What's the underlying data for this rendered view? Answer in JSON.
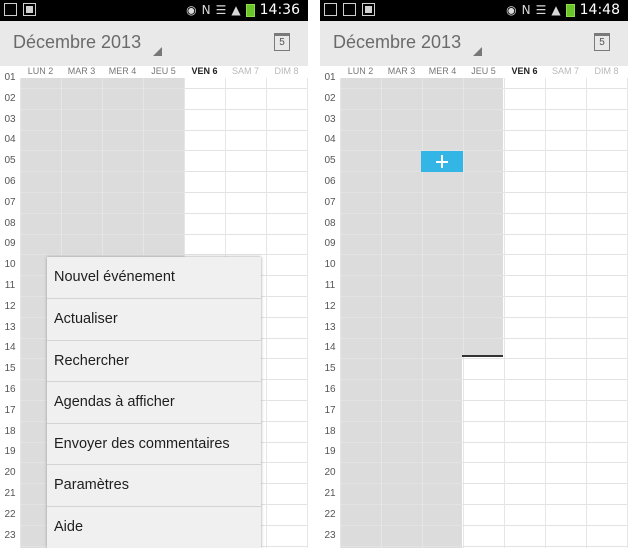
{
  "left": {
    "time": "14:36",
    "month": "Décembre 2013",
    "today_icon": "5",
    "days": [
      {
        "label": "LUN 2"
      },
      {
        "label": "MAR 3"
      },
      {
        "label": "MER 4"
      },
      {
        "label": "JEU 5"
      },
      {
        "label": "VEN 6"
      },
      {
        "label": "SAM 7"
      },
      {
        "label": "DIM 8"
      }
    ],
    "hours": [
      "01",
      "02",
      "03",
      "04",
      "05",
      "06",
      "07",
      "08",
      "09",
      "10",
      "11",
      "12",
      "13",
      "14",
      "15",
      "16",
      "17",
      "18",
      "19",
      "20",
      "21",
      "22",
      "23"
    ],
    "menu": [
      "Nouvel événement",
      "Actualiser",
      "Rechercher",
      "Agendas à afficher",
      "Envoyer des commentaires",
      "Paramètres",
      "Aide"
    ]
  },
  "right": {
    "time": "14:48",
    "month": "Décembre 2013",
    "today_icon": "5",
    "days": [
      {
        "label": "LUN 2"
      },
      {
        "label": "MAR 3"
      },
      {
        "label": "MER 4"
      },
      {
        "label": "JEU 5"
      },
      {
        "label": "VEN 6"
      },
      {
        "label": "SAM 7"
      },
      {
        "label": "DIM 8"
      }
    ],
    "hours": [
      "01",
      "02",
      "03",
      "04",
      "05",
      "06",
      "07",
      "08",
      "09",
      "10",
      "11",
      "12",
      "13",
      "14",
      "15",
      "16",
      "17",
      "18",
      "19",
      "20",
      "21",
      "22",
      "23"
    ]
  },
  "colors": {
    "accent": "#33b5e5",
    "battery": "#6bc42a",
    "shade": "#dcdcdc"
  },
  "icons": [
    "notification-icon",
    "sd-card-icon",
    "eye-icon",
    "nfc-icon",
    "wifi-icon",
    "signal-icon",
    "battery-icon",
    "image-icon",
    "check-icon"
  ]
}
